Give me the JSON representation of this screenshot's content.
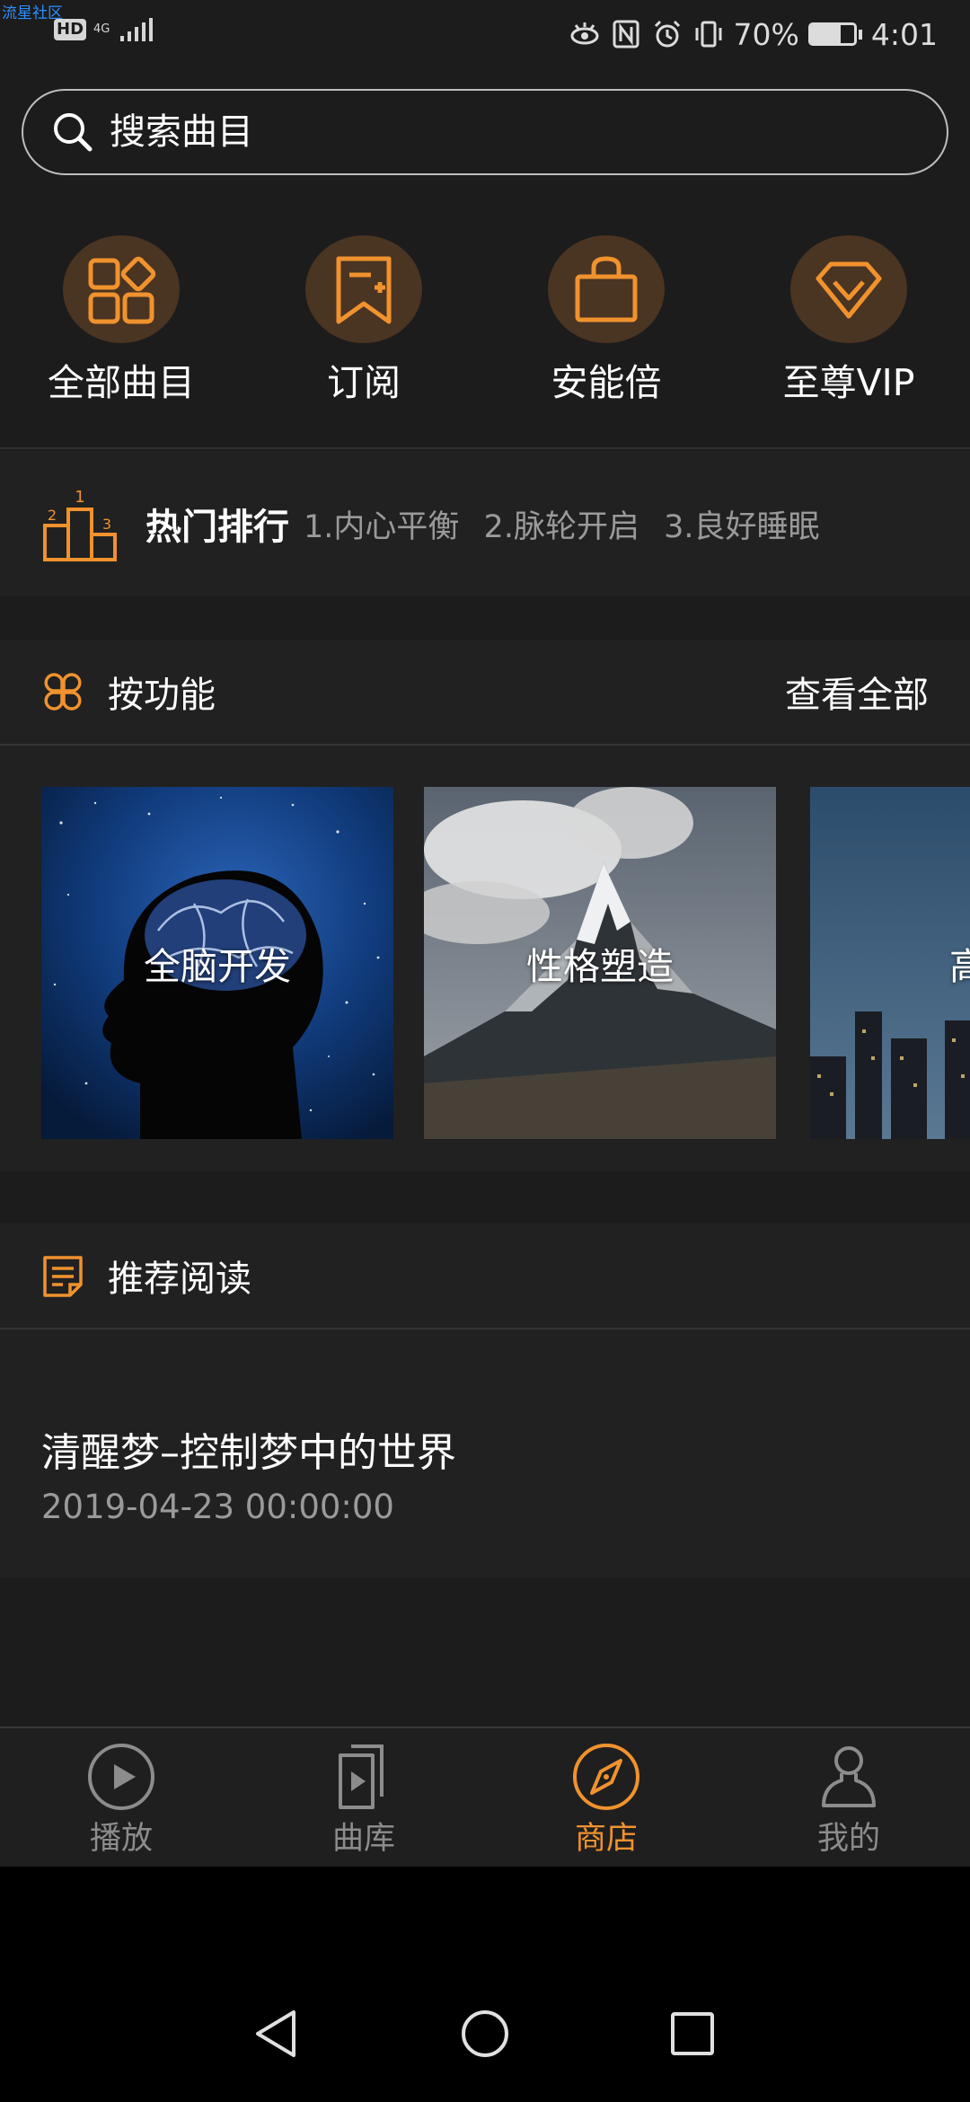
{
  "status_bar": {
    "watermark": "流星社区",
    "hd_badge": "HD",
    "network": "4G",
    "battery_percent_text": "70%",
    "battery_level": 0.7,
    "time": "4:01"
  },
  "search": {
    "placeholder": "搜索曲目"
  },
  "quick_categories": [
    {
      "label": "全部曲目",
      "icon": "grid-icon"
    },
    {
      "label": "订阅",
      "icon": "bookmark-add-icon"
    },
    {
      "label": "安能倍",
      "icon": "shopping-bag-icon"
    },
    {
      "label": "至尊VIP",
      "icon": "vip-diamond-icon"
    }
  ],
  "hot_ranking": {
    "title": "热门排行",
    "items": [
      "1.内心平衡",
      "2.脉轮开启",
      "3.良好睡眠"
    ],
    "icon": "podium-icon"
  },
  "by_function": {
    "title": "按功能",
    "view_all": "查看全部",
    "icon": "clover-icon",
    "cards": [
      {
        "label": "全脑开发"
      },
      {
        "label": "性格塑造"
      },
      {
        "label": "高效"
      }
    ]
  },
  "recommended": {
    "title": "推荐阅读",
    "icon": "note-icon",
    "articles": [
      {
        "title": "清醒梦–控制梦中的世界",
        "date": "2019-04-23 00:00:00"
      }
    ]
  },
  "bottom_nav": [
    {
      "label": "播放",
      "icon": "play-circle-icon",
      "active": false
    },
    {
      "label": "曲库",
      "icon": "library-icon",
      "active": false
    },
    {
      "label": "商店",
      "icon": "compass-icon",
      "active": true
    },
    {
      "label": "我的",
      "icon": "person-icon",
      "active": false
    }
  ],
  "colors": {
    "accent": "#f0922e",
    "background": "#1c1c1c",
    "panel": "#212121",
    "icon_circle": "#4a3422",
    "muted_text": "#9a9a9a"
  }
}
